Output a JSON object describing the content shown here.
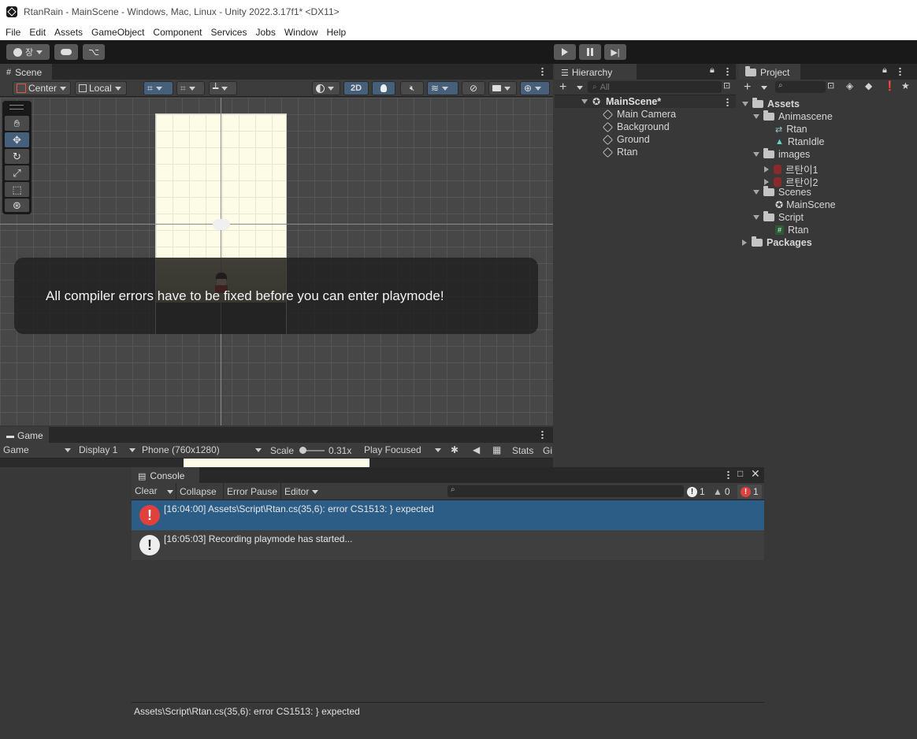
{
  "window": {
    "title": "RtanRain - MainScene - Windows, Mac, Linux - Unity 2022.3.17f1* <DX11>"
  },
  "menu": [
    "File",
    "Edit",
    "Assets",
    "GameObject",
    "Component",
    "Services",
    "Jobs",
    "Window",
    "Help"
  ],
  "toolbar": {
    "account_label": "장"
  },
  "scene": {
    "tab_label": "Scene",
    "pivot_label": "Center",
    "space_label": "Local",
    "mode_2d_label": "2D",
    "overlay_message": "All compiler errors have to be fixed before you can enter playmode!"
  },
  "game": {
    "tab_label": "Game",
    "view_select": "Game",
    "display_select": "Display 1",
    "resolution_select": "Phone (760x1280)",
    "scale_label": "Scale",
    "scale_value": "0.31x",
    "play_mode_select": "Play Focused",
    "stats_label": "Stats",
    "gizmos_label": "Gi"
  },
  "hierarchy": {
    "tab_label": "Hierarchy",
    "search_placeholder": "All",
    "scene_name": "MainScene*",
    "items": [
      "Main Camera",
      "Background",
      "Ground",
      "Rtan"
    ]
  },
  "project": {
    "tab_label": "Project",
    "tree": {
      "assets": "Assets",
      "animascene": "Animascene",
      "rtan_anim": "Rtan",
      "rtan_idle": "RtanIdle",
      "images": "images",
      "img1": "르탄이1",
      "img2": "르탄이2",
      "scenes": "Scenes",
      "mainscene": "MainScene",
      "script": "Script",
      "rtan_script": "Rtan",
      "packages": "Packages"
    }
  },
  "console": {
    "tab_label": "Console",
    "clear_label": "Clear",
    "collapse_label": "Collapse",
    "error_pause_label": "Error Pause",
    "editor_label": "Editor",
    "info_count": "1",
    "warning_count": "0",
    "error_count": "1",
    "logs": [
      "[16:04:00] Assets\\Script\\Rtan.cs(35,6): error CS1513: } expected",
      "[16:05:03] Recording playmode has started..."
    ],
    "detail_text": "Assets\\Script\\Rtan.cs(35,6): error CS1513: } expected"
  },
  "colors": {
    "selected_row": "#2c5d87",
    "error_red": "#e0413c",
    "panel_bg": "#383838",
    "accent_blue": "#46607c"
  }
}
